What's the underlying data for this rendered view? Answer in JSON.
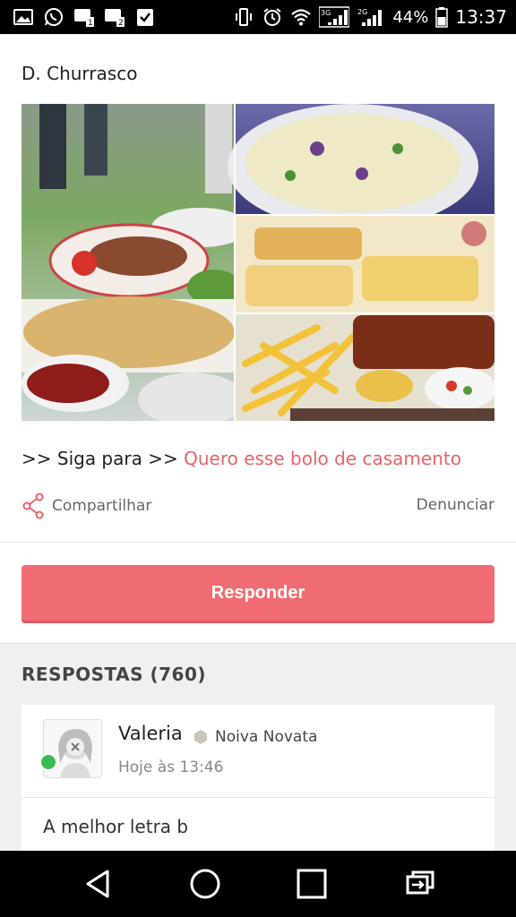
{
  "status_bar": {
    "battery_percent": "44%",
    "time": "13:37",
    "network_3g": "3G",
    "network_2g": "2G",
    "sim1": "1",
    "sim2": "2"
  },
  "post": {
    "title": "D. Churrasco",
    "link_prefix": ">> Siga para >>",
    "link_text": "Quero esse bolo de casamento",
    "share_label": "Compartilhar",
    "report_label": "Denunciar"
  },
  "reply_button": {
    "label": "Responder"
  },
  "answers": {
    "title": "RESPOSTAS (760)",
    "items": [
      {
        "user": "Valeria",
        "badge": "Noiva Novata",
        "time": "Hoje às 13:46",
        "text": "A melhor letra b"
      }
    ]
  },
  "colors": {
    "accent": "#e8636a",
    "button": "#f06d73",
    "online": "#3dbb52"
  },
  "icons": {
    "share": "share-icon",
    "badge": "hexagon-badge-icon",
    "nav_back": "back-triangle-icon",
    "nav_home": "home-circle-icon",
    "nav_recent": "recent-square-icon",
    "nav_switch": "switch-apps-icon"
  }
}
